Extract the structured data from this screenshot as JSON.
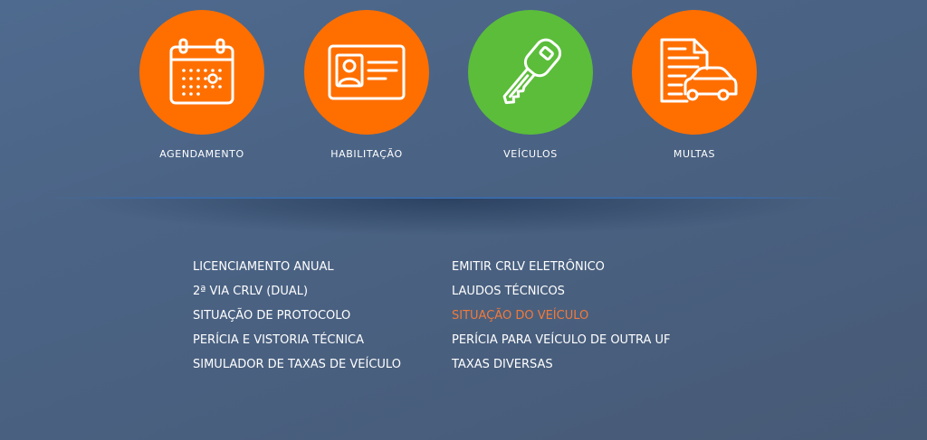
{
  "services": [
    {
      "label": "AGENDAMENTO",
      "icon": "calendar-icon",
      "color": "#ff6f00"
    },
    {
      "label": "HABILITAÇÃO",
      "icon": "driver-license-icon",
      "color": "#ff6f00"
    },
    {
      "label": "VEÍCULOS",
      "icon": "car-key-icon",
      "color": "#5bbd3a"
    },
    {
      "label": "MULTAS",
      "icon": "fine-document-car-icon",
      "color": "#ff6f00"
    }
  ],
  "links": {
    "left": [
      "LICENCIAMENTO ANUAL",
      "2ª VIA CRLV (DUAL)",
      "SITUAÇÃO DE PROTOCOLO",
      "PERÍCIA E VISTORIA TÉCNICA",
      "SIMULADOR DE TAXAS DE VEÍCULO"
    ],
    "right": [
      "EMITIR CRLV ELETRÔNICO",
      "LAUDOS TÉCNICOS",
      "SITUAÇÃO DO VEÍCULO",
      "PERÍCIA PARA VEÍCULO DE OUTRA UF",
      "TAXAS DIVERSAS"
    ],
    "active_link": "SITUAÇÃO DO VEÍCULO",
    "active_color": "#f27a3a"
  }
}
